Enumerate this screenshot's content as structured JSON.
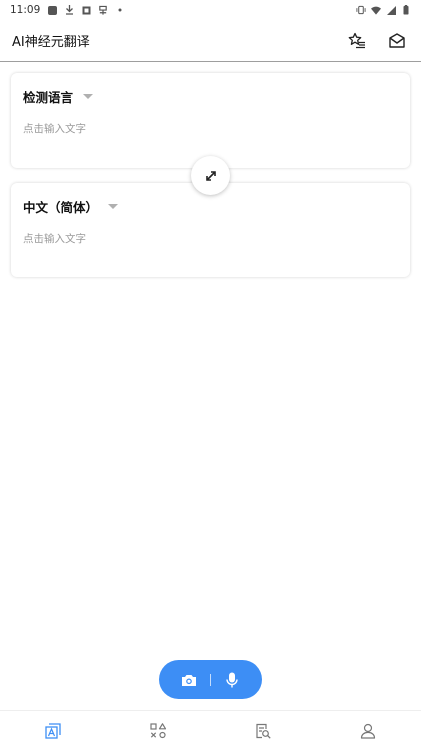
{
  "status_bar": {
    "time": "11:09",
    "icons": [
      "notification-square-icon",
      "download-icon",
      "image-icon",
      "app-icon",
      "dot-icon",
      "vibrate-icon",
      "wifi-icon",
      "signal-icon",
      "battery-icon"
    ]
  },
  "header": {
    "title": "AI神经元翻译",
    "actions": [
      "favorites-list-icon",
      "mail-icon"
    ]
  },
  "source_card": {
    "language": "检测语言",
    "placeholder": "点击输入文字"
  },
  "target_card": {
    "language": "中文（简体）",
    "placeholder": "点击输入文字"
  },
  "swap": {
    "icon": "swap-arrows-icon"
  },
  "action_pill": {
    "color": "#3d8ef5",
    "buttons": [
      "camera-icon",
      "microphone-icon"
    ]
  },
  "bottom_nav": {
    "items": [
      "translate-icon",
      "tools-icon",
      "document-search-icon",
      "profile-icon"
    ],
    "active_index": 0,
    "active_color": "#3d8ef5"
  }
}
